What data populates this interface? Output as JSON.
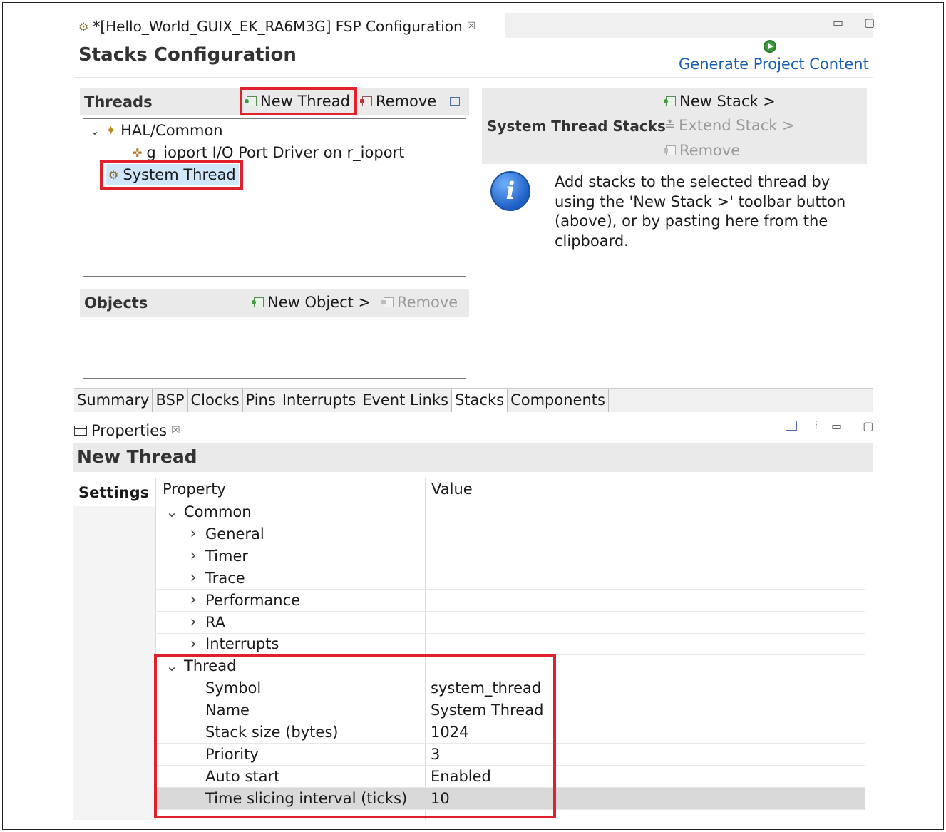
{
  "editor": {
    "tab_title": "*[Hello_World_GUIX_EK_RA6M3G] FSP Configuration",
    "close_glyph": "☒",
    "window_controls": "▭ ▢"
  },
  "page_title": "Stacks Configuration",
  "generate_button": "Generate Project Content",
  "threads_panel": {
    "title": "Threads",
    "new_thread": "New Thread",
    "remove": "Remove",
    "tree": [
      {
        "label": "HAL/Common",
        "expanded": true,
        "level": 0
      },
      {
        "label": "g_ioport I/O Port Driver on r_ioport",
        "level": 1
      },
      {
        "label": "System Thread",
        "level": 0,
        "selected": true
      }
    ]
  },
  "stacks_panel": {
    "title": "System Thread Stacks",
    "new_stack": "New Stack >",
    "extend_stack": "Extend Stack >",
    "remove": "Remove",
    "info_text": "Add stacks to the selected thread by using the 'New Stack >' toolbar button (above), or by pasting here from the clipboard."
  },
  "objects_panel": {
    "title": "Objects",
    "new_object": "New Object >",
    "remove": "Remove"
  },
  "bottom_tabs": [
    "Summary",
    "BSP",
    "Clocks",
    "Pins",
    "Interrupts",
    "Event Links",
    "Stacks",
    "Components"
  ],
  "active_bottom_tab": "Stacks",
  "properties": {
    "tab_label": "Properties",
    "header": "New Thread",
    "settings_tab": "Settings",
    "col_property": "Property",
    "col_value": "Value",
    "rows": [
      {
        "label": "Common",
        "value": "",
        "chevron": "down"
      },
      {
        "label": "General",
        "value": "",
        "chevron": "right"
      },
      {
        "label": "Timer",
        "value": "",
        "chevron": "right"
      },
      {
        "label": "Trace",
        "value": "",
        "chevron": "right"
      },
      {
        "label": "Performance",
        "value": "",
        "chevron": "right"
      },
      {
        "label": "RA",
        "value": "",
        "chevron": "right"
      },
      {
        "label": "Interrupts",
        "value": "",
        "chevron": "right"
      },
      {
        "label": "Thread",
        "value": "",
        "chevron": "down"
      },
      {
        "label": "Symbol",
        "value": "system_thread"
      },
      {
        "label": "Name",
        "value": "System Thread"
      },
      {
        "label": "Stack size (bytes)",
        "value": "1024"
      },
      {
        "label": "Priority",
        "value": "3"
      },
      {
        "label": "Auto start",
        "value": "Enabled"
      },
      {
        "label": "Time slicing interval (ticks)",
        "value": "10",
        "highlighted": true
      }
    ]
  },
  "colors": {
    "highlight_box": "#e0202a",
    "link": "#1a5fb4",
    "selection": "#cfe6fb"
  }
}
